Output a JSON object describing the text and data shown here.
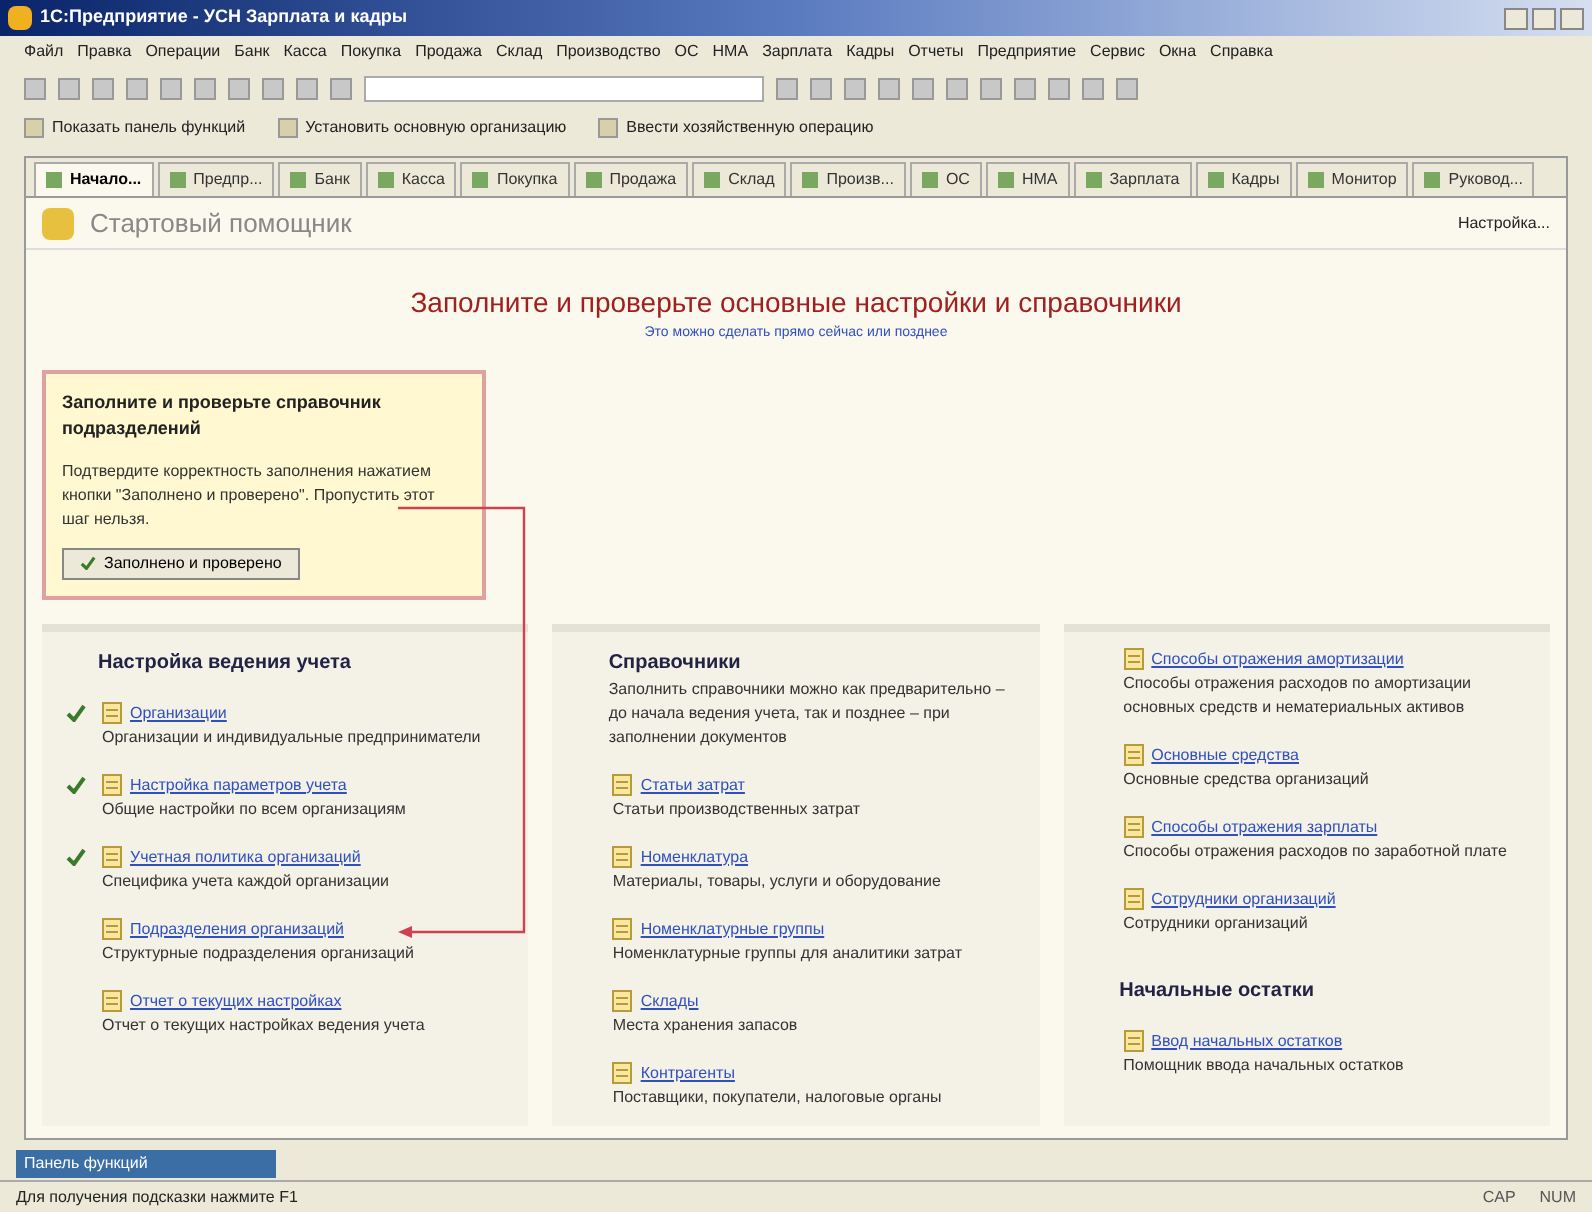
{
  "window": {
    "title": "1С:Предприятие - УСН Зарплата и кадры"
  },
  "menu": [
    "Файл",
    "Правка",
    "Операции",
    "Банк",
    "Касса",
    "Покупка",
    "Продажа",
    "Склад",
    "Производство",
    "ОС",
    "НМА",
    "Зарплата",
    "Кадры",
    "Отчеты",
    "Предприятие",
    "Сервис",
    "Окна",
    "Справка"
  ],
  "toolbar2": [
    "Показать панель функций",
    "Установить основную организацию",
    "Ввести хозяйственную операцию"
  ],
  "tabs": [
    {
      "label": "Начало...",
      "selected": true
    },
    {
      "label": "Предпр...",
      "selected": false
    },
    {
      "label": "Банк",
      "selected": false
    },
    {
      "label": "Касса",
      "selected": false
    },
    {
      "label": "Покупка",
      "selected": false
    },
    {
      "label": "Продажа",
      "selected": false
    },
    {
      "label": "Склад",
      "selected": false
    },
    {
      "label": "Произв...",
      "selected": false
    },
    {
      "label": "ОС",
      "selected": false
    },
    {
      "label": "НМА",
      "selected": false
    },
    {
      "label": "Зарплата",
      "selected": false
    },
    {
      "label": "Кадры",
      "selected": false
    },
    {
      "label": "Монитор",
      "selected": false
    },
    {
      "label": "Руковод...",
      "selected": false
    }
  ],
  "page": {
    "title": "Стартовый помощник",
    "settings_button": "Настройка...",
    "heading": "Заполните и проверьте основные настройки и справочники",
    "subheading": "Это можно сделать прямо сейчас или позднее"
  },
  "callout": {
    "title": "Заполните и проверьте справочник подразделений",
    "text": "Подтвердите корректность заполнения нажатием кнопки \"Заполнено и проверено\". Пропустить этот шаг нельзя.",
    "button": "Заполнено и проверено"
  },
  "columns": [
    {
      "heading": "Настройка ведения учета",
      "items": [
        {
          "link": "Организации",
          "description": "Организации и индивидуальные предприниматели",
          "checked": true
        },
        {
          "link": "Настройка параметров учета",
          "description": "Общие настройки по всем организациям",
          "checked": true
        },
        {
          "link": "Учетная политика организаций",
          "description": "Специфика учета каждой организации",
          "checked": true
        },
        {
          "link": "Подразделения организаций",
          "description": "Структурные подразделения организаций",
          "checked": false
        },
        {
          "link": "Отчет о текущих настройках",
          "description": "Отчет о текущих настройках ведения учета",
          "checked": false
        }
      ]
    },
    {
      "heading": "Справочники",
      "description": "Заполнить справочники можно как предварительно – до начала ведения учета, так и позднее – при заполнении документов",
      "items": [
        {
          "link": "Статьи затрат",
          "description": "Статьи производственных затрат"
        },
        {
          "link": "Номенклатура",
          "description": "Материалы, товары, услуги и оборудование"
        },
        {
          "link": "Номенклатурные группы",
          "description": "Номенклатурные группы для аналитики затрат"
        },
        {
          "link": "Склады",
          "description": "Места хранения запасов"
        },
        {
          "link": "Контрагенты",
          "description": "Поставщики, покупатели, налоговые органы"
        }
      ]
    },
    {
      "items": [
        {
          "link": "Способы отражения амортизации",
          "description": "Способы отражения расходов по амортизации основных средств и нематериальных активов"
        },
        {
          "link": "Основные средства",
          "description": "Основные средства организаций"
        },
        {
          "link": "Способы отражения зарплаты",
          "description": "Способы отражения расходов по заработной плате"
        },
        {
          "link": "Сотрудники организаций",
          "description": "Сотрудники организаций"
        }
      ],
      "heading2": "Начальные остатки",
      "items2": [
        {
          "link": "Ввод начальных остатков",
          "description": "Помощник ввода начальных остатков"
        }
      ]
    }
  ],
  "taskbar": {
    "button": "Панель функций"
  },
  "status_bar": {
    "hint": "Для получения подсказки нажмите F1",
    "indicators": [
      "CAP",
      "NUM"
    ]
  }
}
